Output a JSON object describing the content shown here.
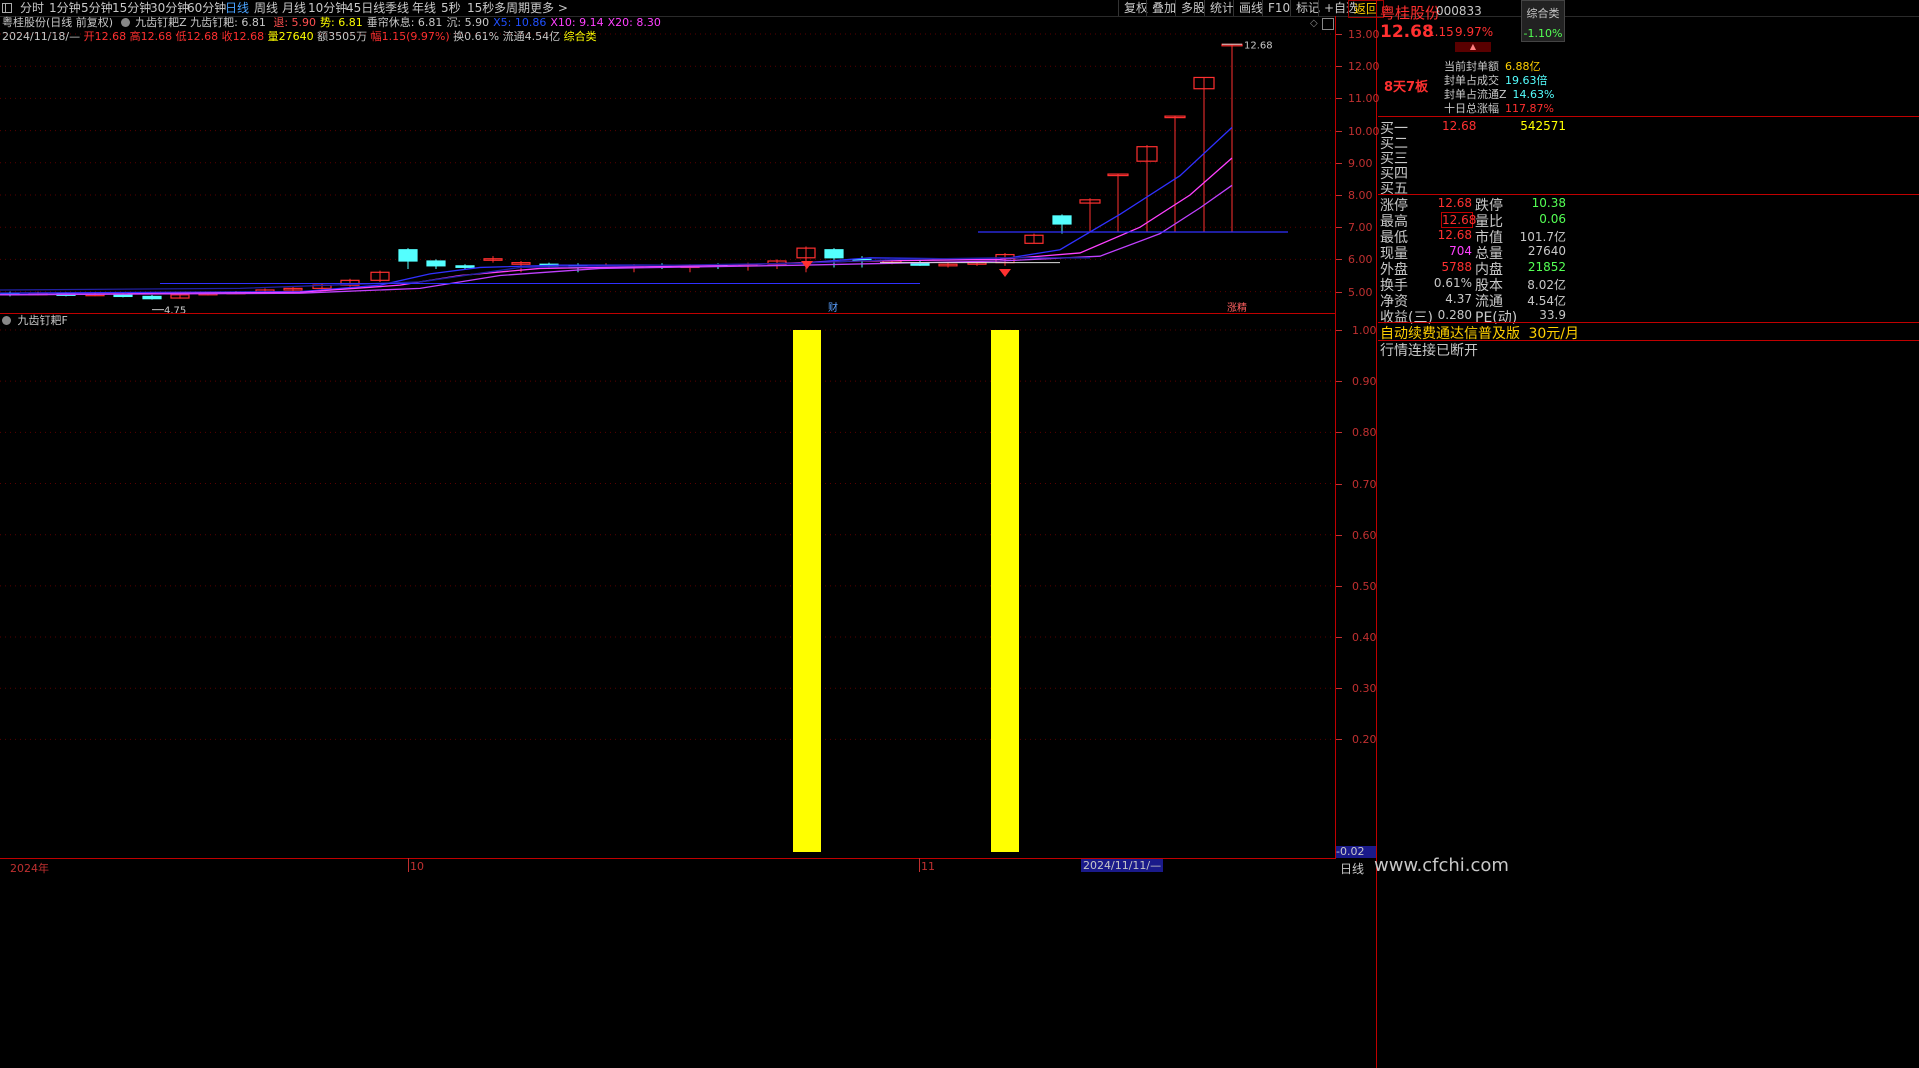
{
  "toolbar": {
    "periods": [
      "分时",
      "1分钟",
      "5分钟",
      "15分钟",
      "30分钟",
      "60分钟",
      "日线",
      "周线",
      "月线",
      "10分钟",
      "45日线",
      "季线",
      "年线",
      "5秒",
      "15秒",
      "多周期",
      "更多 >"
    ],
    "active_period": "日线",
    "right_buttons": [
      "复权",
      "叠加",
      "多股",
      "统计",
      "画线",
      "F10",
      "标记",
      "+自选",
      "返回"
    ],
    "return_label": "返回"
  },
  "stock": {
    "name": "粤桂股份",
    "code": "000833",
    "price": "12.68",
    "change": "1.15",
    "change_pct": "9.97%",
    "index_name": "综合类",
    "index_change": "-1.10%",
    "board_tag": "8天7板"
  },
  "chart_header": {
    "line1": {
      "title": "粤桂股份(日线 前复权)",
      "indicator": "九齿钉耙Z 九齿钉耙: 6.81",
      "items": [
        {
          "label": "退: 5.90",
          "color": "#ff5050"
        },
        {
          "label": "势: 6.81",
          "color": "#ffff00"
        },
        {
          "label": "垂帘休息: 6.81",
          "color": "#c8c8c8"
        },
        {
          "label": "沉: 5.90",
          "color": "#c8c8c8"
        },
        {
          "label": "X5: 10.86",
          "color": "#2050ff"
        },
        {
          "label": "X10: 9.14",
          "color": "#ff40ff"
        },
        {
          "label": "X20: 8.30",
          "color": "#ff40ff"
        }
      ]
    },
    "line2": {
      "date": "2024/11/18/—",
      "open": "开12.68",
      "high": "高12.68",
      "low": "低12.68",
      "close": "收12.68",
      "vol": "量27640",
      "amount": "额3505万",
      "amp": "幅1.15(9.97%)",
      "turnover": "换0.61%",
      "float": "流通4.54亿",
      "sector": "综合类"
    }
  },
  "price_axis": [
    "13.00",
    "12.00",
    "11.00",
    "10.00",
    "9.00",
    "8.00",
    "7.00",
    "6.00",
    "5.00"
  ],
  "chart_annotations": {
    "high_label": "12.68",
    "low_label": "4.75",
    "fin_marker": "财",
    "limit_marker": "涨精"
  },
  "sub_indicator": {
    "title": "九齿钉耙F",
    "axis": [
      "1.00",
      "0.90",
      "0.80",
      "0.70",
      "0.60",
      "0.50",
      "0.40",
      "0.30",
      "0.20"
    ],
    "bottom_value": "-0.02"
  },
  "time_axis": {
    "labels": [
      "2024年",
      "10",
      "11"
    ],
    "cursor_date": "2024/11/11/—",
    "period": "日线"
  },
  "seal_info": [
    {
      "label": "当前封单额",
      "value": "6.88亿"
    },
    {
      "label": "封单占成交",
      "value": "19.63倍"
    },
    {
      "label": "封单占流通Z",
      "value": "14.63%"
    },
    {
      "label": "十日总涨幅",
      "value": "117.87%"
    }
  ],
  "order_book": {
    "buy": [
      {
        "label": "买一",
        "price": "12.68",
        "vol": "542571"
      },
      {
        "label": "买二",
        "price": "",
        "vol": ""
      },
      {
        "label": "买三",
        "price": "",
        "vol": ""
      },
      {
        "label": "买四",
        "price": "",
        "vol": ""
      },
      {
        "label": "买五",
        "price": "",
        "vol": ""
      }
    ]
  },
  "quote_table": [
    {
      "l1": "涨停",
      "v1": "12.68",
      "l2": "跌停",
      "v2": "10.38"
    },
    {
      "l1": "最高",
      "v1": "12.68",
      "l2": "量比",
      "v2": "0.06"
    },
    {
      "l1": "最低",
      "v1": "12.68",
      "l2": "市值",
      "v2": "101.7亿"
    },
    {
      "l1": "现量",
      "v1": "704",
      "l2": "总量",
      "v2": "27640"
    },
    {
      "l1": "外盘",
      "v1": "5788",
      "l2": "内盘",
      "v2": "21852"
    },
    {
      "l1": "换手",
      "v1": "0.61%",
      "l2": "股本",
      "v2": "8.02亿"
    },
    {
      "l1": "净资",
      "v1": "4.37",
      "l2": "流通",
      "v2": "4.54亿"
    },
    {
      "l1": "收益(三)",
      "v1": "0.280",
      "l2": "PE(动)",
      "v2": "33.9"
    }
  ],
  "promo": {
    "text": "自动续费通达信普及版",
    "price": "30元/月"
  },
  "connection_status": "行情连接已断开",
  "watermark": "www.cfchi.com",
  "colors": {
    "up": "#ff3030",
    "down": "#54ffff",
    "grid": "#6b0000",
    "axis": "#c03030",
    "yellow": "#ffff00",
    "bar": "#ffff00"
  },
  "chart_data": {
    "type": "bar",
    "title": "九齿钉耙F",
    "series": [
      {
        "values": [
          1,
          1
        ]
      }
    ],
    "ylim": [
      -0.02,
      1.0
    ]
  }
}
